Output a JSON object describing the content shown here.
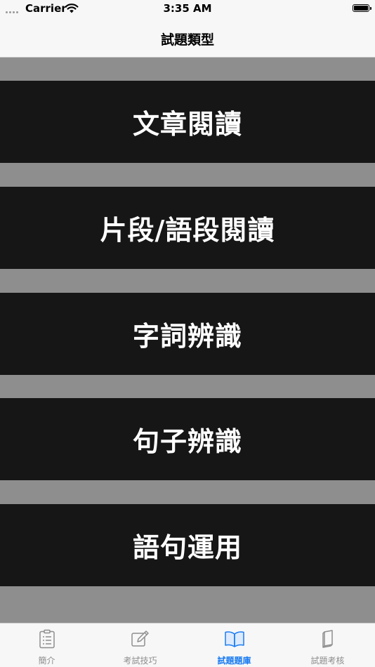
{
  "status_bar": {
    "carrier": "Carrier",
    "time": "3:35 AM"
  },
  "nav": {
    "title": "試題類型"
  },
  "categories": [
    {
      "label": "文章閱讀"
    },
    {
      "label": "片段/語段閱讀"
    },
    {
      "label": "字詞辨識"
    },
    {
      "label": "句子辨識"
    },
    {
      "label": "語句運用"
    }
  ],
  "tabs": [
    {
      "label": "簡介",
      "icon": "clipboard-list-icon",
      "active": false
    },
    {
      "label": "考試技巧",
      "icon": "pencil-note-icon",
      "active": false
    },
    {
      "label": "試題題庫",
      "icon": "open-book-icon",
      "active": true
    },
    {
      "label": "試題考核",
      "icon": "book-icon",
      "active": false
    }
  ],
  "colors": {
    "active_tab": "#1a7cf2",
    "inactive_tab": "#8e8e8e",
    "category_background": "#161616",
    "page_background": "#8e8e8e"
  }
}
